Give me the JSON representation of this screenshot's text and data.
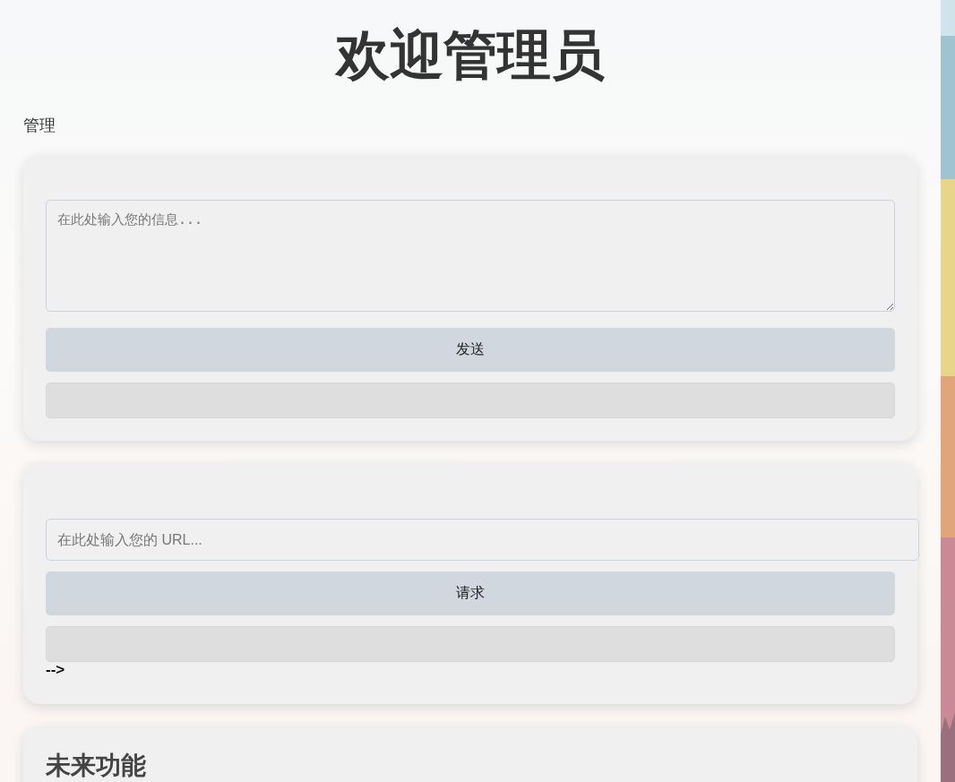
{
  "title": "欢迎管理员",
  "section_label": "管理",
  "message_panel": {
    "placeholder": "在此处输入您的信息...",
    "button": "发送"
  },
  "url_panel": {
    "placeholder": "在此处输入您的 URL...",
    "button": "请求",
    "trailing_text": "-->"
  },
  "future_panel": {
    "heading": "未来功能"
  }
}
